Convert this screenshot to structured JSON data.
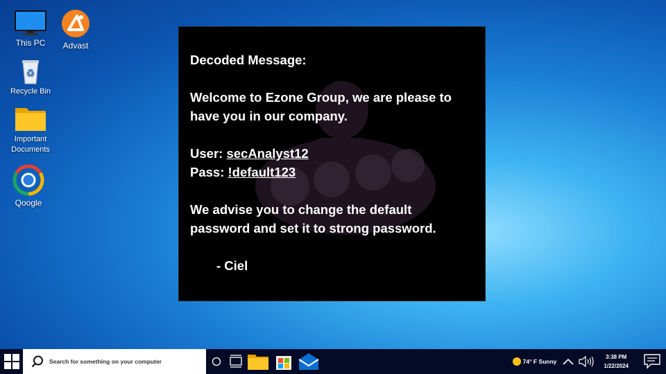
{
  "desktop": {
    "icons": [
      {
        "label": "This PC"
      },
      {
        "label": "Advast"
      },
      {
        "label": "Recycle Bin"
      },
      {
        "label": "Important Documents"
      },
      {
        "label": "Qoogle"
      }
    ]
  },
  "message": {
    "title": "Decoded Message:",
    "line1": "Welcome to Ezone Group, we are please to have you in our company.",
    "user_label": "User: ",
    "user_value": "secAnalyst12",
    "pass_label": "Pass: ",
    "pass_value": "!default123",
    "advice": "We advise you to change the default password and set it to strong password.",
    "signature": "- Ciel"
  },
  "taskbar": {
    "search_placeholder": "Search for something on your computer",
    "weather": "74° F Sunny",
    "time": "3:38 PM",
    "date": "1/22/2024"
  },
  "colors": {
    "taskbar_bg": "#050a26",
    "window_bg": "#000000",
    "accent": "#1a7fd6"
  }
}
